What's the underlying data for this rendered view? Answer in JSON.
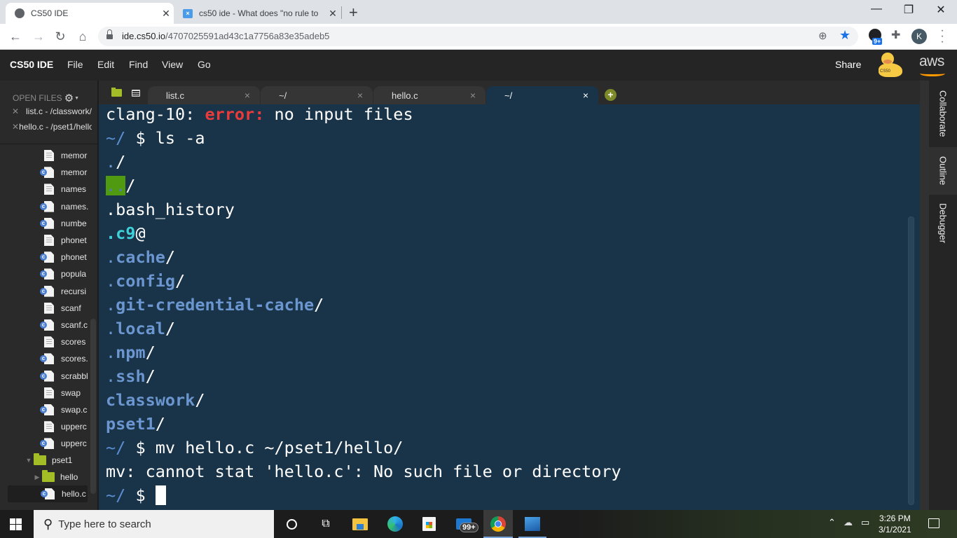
{
  "browser": {
    "tabs": [
      {
        "title": "CS50 IDE",
        "favicon": "globe-icon",
        "active": true
      },
      {
        "title": "cs50 ide - What does \"no rule to",
        "favicon": "stackexchange-icon",
        "active": false
      }
    ],
    "new_tab_symbol": "+",
    "window_controls": {
      "minimize": "—",
      "restore": "❐",
      "close": "✕"
    },
    "nav": {
      "back": "←",
      "forward": "→",
      "reload": "↻",
      "home": "⌂"
    },
    "url_host": "ide.cs50.io",
    "url_path": "/4707025591ad43c1a7756a83e35adeb5",
    "extension_badge": "9+",
    "profile_initial": "K"
  },
  "ide": {
    "brand": "CS50 IDE",
    "menus": [
      "File",
      "Edit",
      "Find",
      "View",
      "Go"
    ],
    "share_label": "Share",
    "duck_label": "CS50",
    "aws_label": "aws"
  },
  "left_panel": {
    "open_files_header": "OPEN FILES",
    "open_files": [
      {
        "label": "list.c - /classwork/"
      },
      {
        "label": "hello.c - /pset1/hello"
      }
    ],
    "tree": [
      {
        "name": "memor",
        "type": "text"
      },
      {
        "name": "memor",
        "type": "c"
      },
      {
        "name": "names",
        "type": "text"
      },
      {
        "name": "names.",
        "type": "c"
      },
      {
        "name": "numbe",
        "type": "c"
      },
      {
        "name": "phonet",
        "type": "text"
      },
      {
        "name": "phonet",
        "type": "c"
      },
      {
        "name": "popula",
        "type": "c"
      },
      {
        "name": "recursi",
        "type": "c"
      },
      {
        "name": "scanf",
        "type": "text"
      },
      {
        "name": "scanf.c",
        "type": "c"
      },
      {
        "name": "scores",
        "type": "text"
      },
      {
        "name": "scores.",
        "type": "c"
      },
      {
        "name": "scrabbl",
        "type": "c"
      },
      {
        "name": "swap",
        "type": "text"
      },
      {
        "name": "swap.c",
        "type": "c"
      },
      {
        "name": "upperc",
        "type": "text"
      },
      {
        "name": "upperc",
        "type": "c"
      }
    ],
    "folders": [
      {
        "name": "pset1",
        "expanded": true
      },
      {
        "name": "hello",
        "expanded": false
      }
    ],
    "selected_file": "hello.c"
  },
  "editor_tabs": [
    {
      "label": "list.c",
      "active": false
    },
    {
      "label": "~/",
      "active": false
    },
    {
      "label": "hello.c",
      "active": false
    },
    {
      "label": "~/",
      "active": true
    }
  ],
  "close_symbol": "×",
  "add_tab_symbol": "+",
  "terminal": {
    "line1": {
      "prefix": "clang-10: ",
      "error": "error:",
      "rest": " no input files"
    },
    "prompt": "~/",
    "dollar": " $ ",
    "cmd1": "ls -a",
    "ls_output": {
      "dot": ".",
      "dotdot": "..",
      "slash": "/",
      "bash_history": ".bash_history",
      "c9_dot": ".",
      "c9": "c9",
      "c9_suffix": "@",
      "cache": "cache",
      "config": "config",
      "git_credential_cache": "git-credential-cache",
      "local": "local",
      "npm": "npm",
      "ssh": "ssh",
      "classwork": "classwork",
      "pset1": "pset1"
    },
    "cmd2": "mv hello.c ~/pset1/hello/",
    "error2": "mv: cannot stat 'hello.c': No such file or directory"
  },
  "right_panel": {
    "tabs": [
      "Collaborate",
      "Outline",
      "Debugger"
    ],
    "active": "Outline"
  },
  "taskbar": {
    "search_placeholder": "Type here to search",
    "mail_badge": "99+",
    "time": "3:26 PM",
    "date": "3/1/2021",
    "tray_chevron": "^"
  }
}
